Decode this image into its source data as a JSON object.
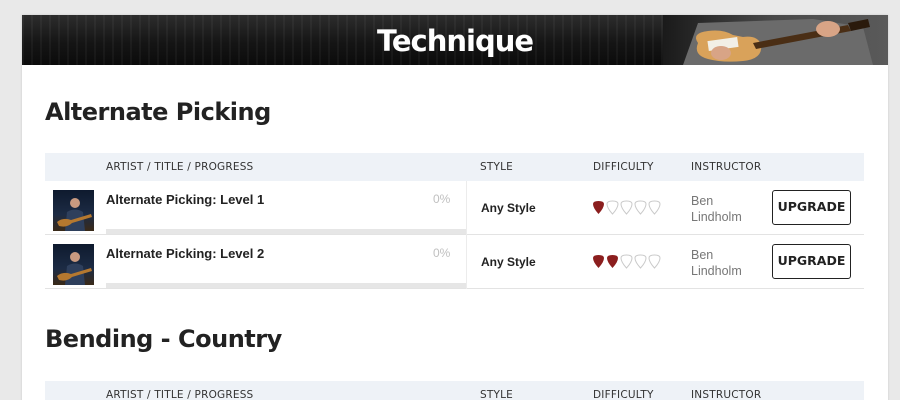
{
  "banner": {
    "title": "Technique",
    "image_icon": "guitarist-photo"
  },
  "headers": {
    "artist": "ARTIST / TITLE / PROGRESS",
    "style": "STYLE",
    "difficulty": "DIFFICULTY",
    "instructor": "INSTRUCTOR"
  },
  "sections": [
    {
      "title": "Alternate Picking",
      "lessons": [
        {
          "title": "Alternate Picking: Level 1",
          "progress": "0%",
          "progress_fraction": 0,
          "style": "Any Style",
          "difficulty_level": 1,
          "difficulty_max": 5,
          "instructor_first": "Ben",
          "instructor_last": "Lindholm",
          "action": "UPGRADE"
        },
        {
          "title": "Alternate Picking: Level 2",
          "progress": "0%",
          "progress_fraction": 0,
          "style": "Any Style",
          "difficulty_level": 2,
          "difficulty_max": 5,
          "instructor_first": "Ben",
          "instructor_last": "Lindholm",
          "action": "UPGRADE"
        }
      ]
    },
    {
      "title": "Bending - Country",
      "lessons": []
    }
  ],
  "colors": {
    "pick_filled": "#8b1e1e",
    "pick_empty_stroke": "#c9c9c9",
    "header_bg": "#eef2f7"
  }
}
